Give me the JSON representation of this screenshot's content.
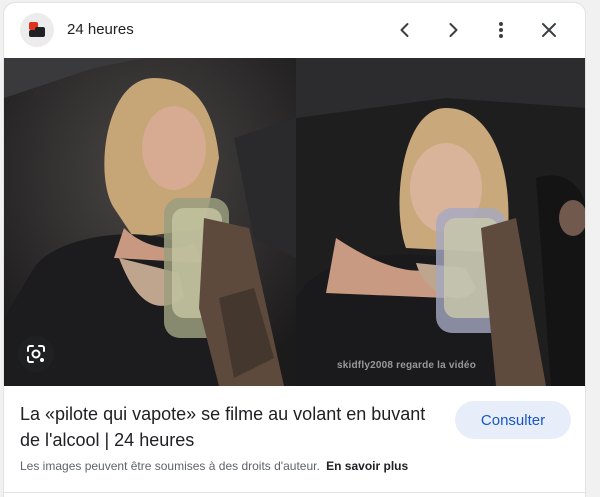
{
  "header": {
    "site_name": "24 heures",
    "logo_icon": "24-heures-logo",
    "prev_icon": "chevron-left-icon",
    "next_icon": "chevron-right-icon",
    "more_icon": "more-vert-icon",
    "close_icon": "close-icon"
  },
  "image": {
    "watermark": "skidfly2008 regarde la vidéo",
    "lens_icon": "google-lens-icon"
  },
  "result": {
    "title": "La «pilote qui vapote» se filme au volant en buvant de l'alcool | 24 heures",
    "visit_label": "Consulter"
  },
  "notice": {
    "text": "Les images peuvent être soumises à des droits d'auteur.",
    "link": "En savoir plus"
  },
  "colors": {
    "accent": "#1a56c5",
    "button_bg": "#e8eef9",
    "logo_red": "#e0321c"
  }
}
